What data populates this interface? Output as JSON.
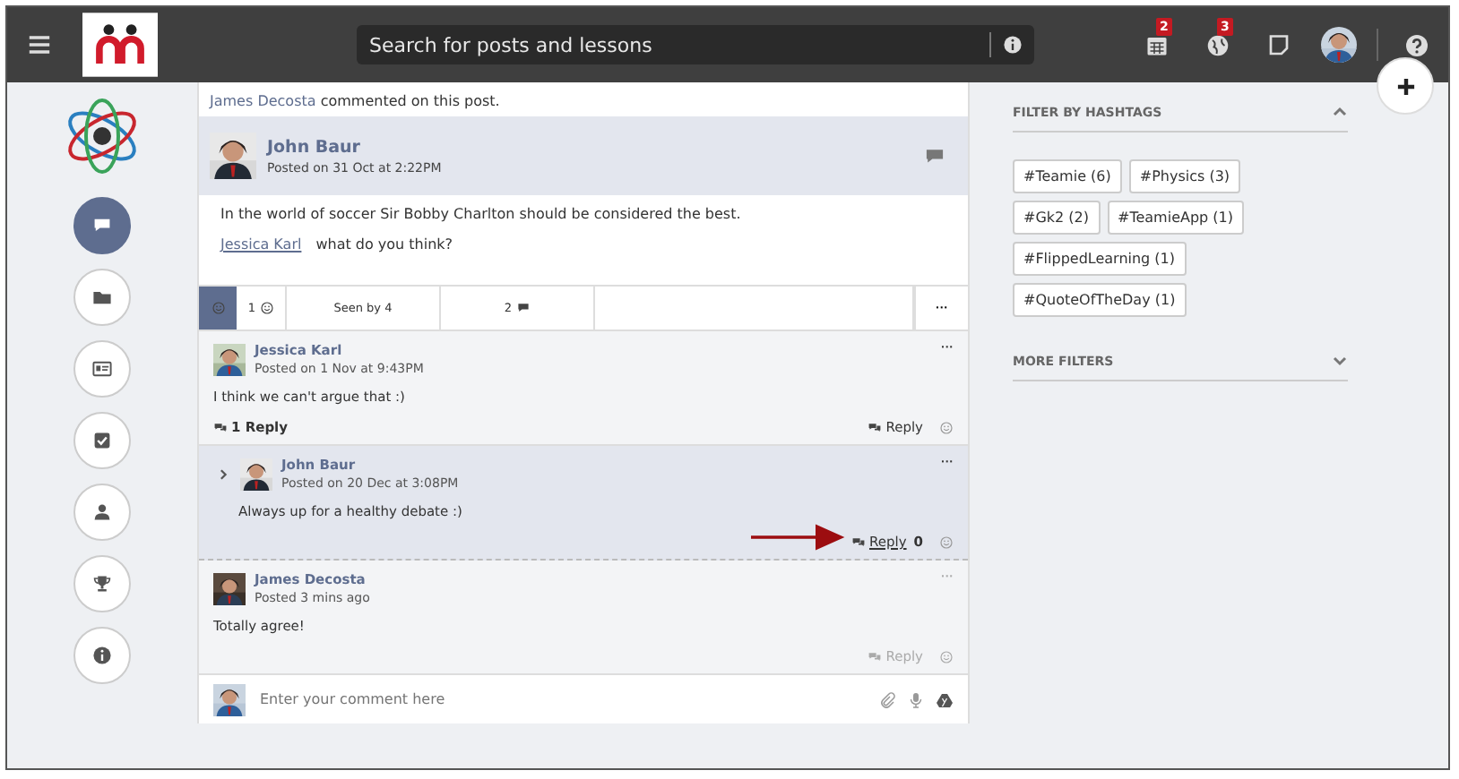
{
  "topbar": {
    "search": {
      "placeholder": "Search for posts and lessons"
    },
    "icons": [
      {
        "kind": "calendar",
        "badge": "2"
      },
      {
        "kind": "globe",
        "badge": "3"
      },
      {
        "kind": "note"
      },
      {
        "kind": "avatar"
      },
      {
        "kind": "help"
      }
    ]
  },
  "sidebar": {
    "items": [
      {
        "kind": "chat",
        "selected": true
      },
      {
        "kind": "folder",
        "selected": false
      },
      {
        "kind": "card",
        "selected": false
      },
      {
        "kind": "check",
        "selected": false
      },
      {
        "kind": "person",
        "selected": false
      },
      {
        "kind": "trophy",
        "selected": false
      },
      {
        "kind": "info",
        "selected": false
      }
    ]
  },
  "post": {
    "activity": {
      "actor": "James Decosta",
      "text": "commented on this post."
    },
    "author": "John Baur",
    "posted": "Posted on 31 Oct at 2:22PM",
    "body": "In the world of soccer Sir Bobby Charlton should be considered the best.",
    "mention": "Jessica Karl",
    "mention_text": "what do you think?",
    "stats": {
      "likes": "1",
      "seen": "Seen by 4",
      "comments": "2",
      "more": "···"
    },
    "comments": [
      {
        "author": "Jessica Karl",
        "posted": "Posted on 1 Nov at 9:43PM",
        "text": "I think we can't argue that :)",
        "replies_label": "1 Reply",
        "reply": "Reply",
        "faded": false,
        "highlighted": false,
        "children": [
          {
            "author": "John Baur",
            "posted": "Posted on 20 Dec at 3:08PM",
            "text": "Always up for a healthy debate :)",
            "reply": "Reply",
            "count": "0",
            "faded": false,
            "highlighted": true
          }
        ]
      },
      {
        "author": "James Decosta",
        "posted": "Posted 3 mins ago",
        "text": "Totally agree!",
        "reply": "Reply",
        "faded": true,
        "highlighted": false
      }
    ],
    "composer": {
      "placeholder": "Enter your comment here"
    }
  },
  "filters": {
    "hashtags_title": "FILTER BY HASHTAGS",
    "expanded": true,
    "hashtags": [
      "#Teamie (6)",
      "#Physics (3)",
      "#Gk2 (2)",
      "#TeamieApp (1)",
      "#FlippedLearning (1)",
      "#QuoteOfTheDay (1)"
    ],
    "more_title": "MORE FILTERS",
    "more_expanded": false
  }
}
